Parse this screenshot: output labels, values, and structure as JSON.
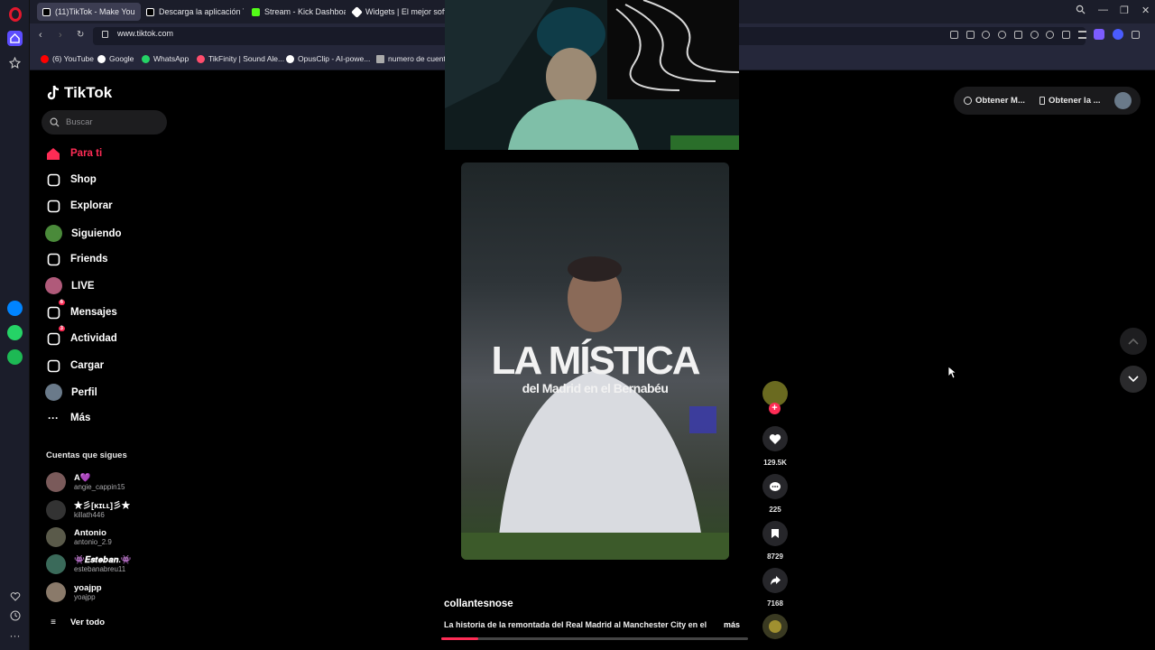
{
  "browser": {
    "tabs": [
      {
        "label": "(11)TikTok - Make You",
        "active": true,
        "color": "#ffffff"
      },
      {
        "label": "Descarga la aplicación Tik",
        "active": false,
        "color": "#ffffff"
      },
      {
        "label": "Stream - Kick Dashboard",
        "active": false,
        "color": "#53fc18"
      },
      {
        "label": "Widgets | El mejor softwa",
        "active": false,
        "color": "#ffffff"
      }
    ],
    "url": "www.tiktok.com",
    "bookmarks": [
      {
        "label": "(6) YouTube",
        "color": "#ff0000"
      },
      {
        "label": "Google",
        "color": "#ffffff"
      },
      {
        "label": "WhatsApp",
        "color": "#25d366"
      },
      {
        "label": "TikFinity | Sound Ale...",
        "color": "#ff4d6d"
      },
      {
        "label": "OpusClip - AI-powe...",
        "color": "#ffffff"
      },
      {
        "label": "numero de cuent",
        "color": "#aaaaaa"
      }
    ]
  },
  "tiktok": {
    "logo": "TikTok",
    "search_placeholder": "Buscar",
    "nav": [
      {
        "label": "Para ti",
        "icon": "home-icon",
        "active": true,
        "badge": ""
      },
      {
        "label": "Shop",
        "icon": "shop-bag-icon",
        "active": false,
        "badge": ""
      },
      {
        "label": "Explorar",
        "icon": "compass-icon",
        "active": false,
        "badge": ""
      },
      {
        "label": "Siguiendo",
        "icon": "following-avatar-icon",
        "active": false,
        "badge": ""
      },
      {
        "label": "Friends",
        "icon": "friends-icon",
        "active": false,
        "badge": ""
      },
      {
        "label": "LIVE",
        "icon": "live-avatar-icon",
        "active": false,
        "badge": ""
      },
      {
        "label": "Mensajes",
        "icon": "messages-icon",
        "active": false,
        "badge": "6"
      },
      {
        "label": "Actividad",
        "icon": "activity-icon",
        "active": false,
        "badge": "3"
      },
      {
        "label": "Cargar",
        "icon": "upload-icon",
        "active": false,
        "badge": ""
      },
      {
        "label": "Perfil",
        "icon": "profile-avatar-icon",
        "active": false,
        "badge": ""
      },
      {
        "label": "Más",
        "icon": "more-dots-icon",
        "active": false,
        "badge": ""
      }
    ],
    "accent_color": "#fe2c55",
    "following_title": "Cuentas que sigues",
    "following": [
      {
        "name": "A💜",
        "handle": "angie_cappin15"
      },
      {
        "name": "★彡[ᴋɪʟʟ]彡★",
        "handle": "killath446"
      },
      {
        "name": "Antonio",
        "handle": "antonio_2.9"
      },
      {
        "name": "👾𝑬𝒔𝒕𝒆𝒃𝒂𝒏.👾",
        "handle": "estebanabreu11"
      },
      {
        "name": "yoajpp",
        "handle": "yoajpp"
      }
    ],
    "see_all": "Ver todo",
    "top_right": {
      "btn1": "Obtener M...",
      "btn2": "Obtener la ..."
    },
    "video": {
      "title_main": "LA MÍSTICA",
      "title_sub": "del Madrid en el Bernabéu",
      "author": "collantesnose",
      "description": "La historia de la remontada del Real Madrid al Manchester City en el",
      "more": "más",
      "likes": "129.5K",
      "comments": "225",
      "saves": "8729",
      "shares": "7168",
      "progress": 0.12
    }
  }
}
